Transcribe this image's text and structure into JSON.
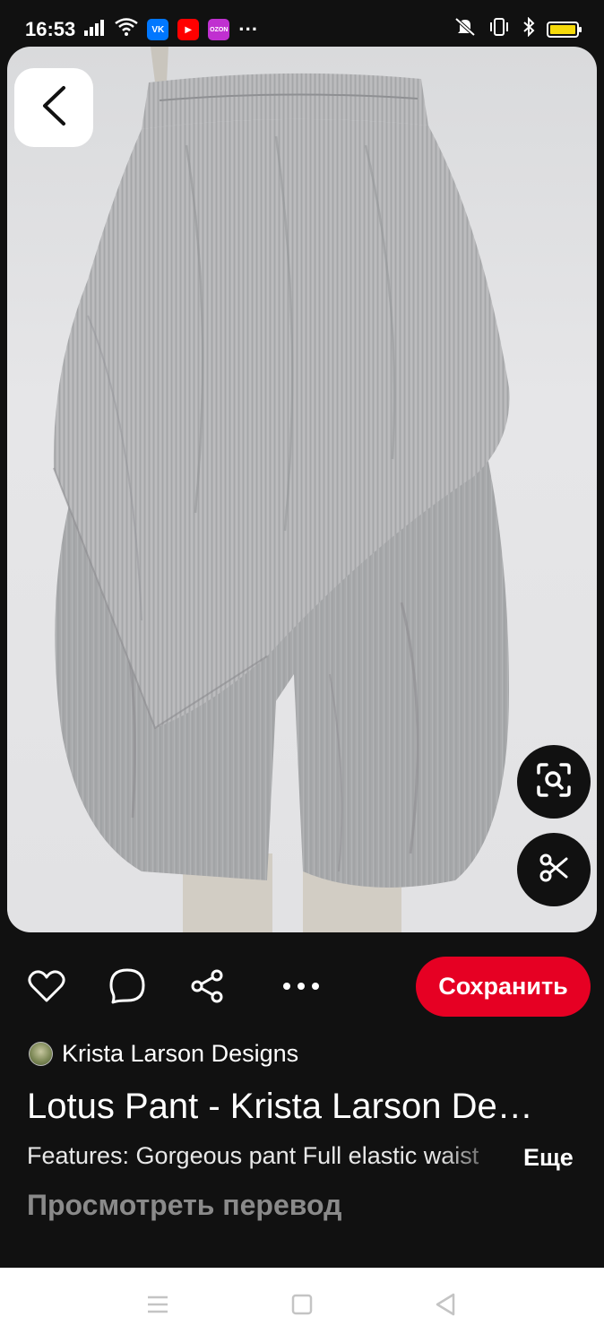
{
  "status_bar": {
    "time": "16:53",
    "app_badges": [
      {
        "label": "VK",
        "color": "#0077ff"
      },
      {
        "label": "▶",
        "color": "#ff0000"
      },
      {
        "label": "OZON",
        "color": "#c030d0"
      }
    ],
    "more": "···"
  },
  "pin": {
    "image_icon": "pants-photo",
    "back_icon": "chevron-left-icon",
    "lens_icon": "visual-search-icon",
    "crop_icon": "scissors-icon"
  },
  "actions": {
    "save_label": "Сохранить",
    "save_color": "#e60023"
  },
  "author": {
    "name": "Krista Larson Designs"
  },
  "title": "Lotus Pant - Krista Larson De…",
  "description": "Features: Gorgeous pant Full elastic waist",
  "more_label": "Еще",
  "translate_label": "Просмотреть перевод"
}
